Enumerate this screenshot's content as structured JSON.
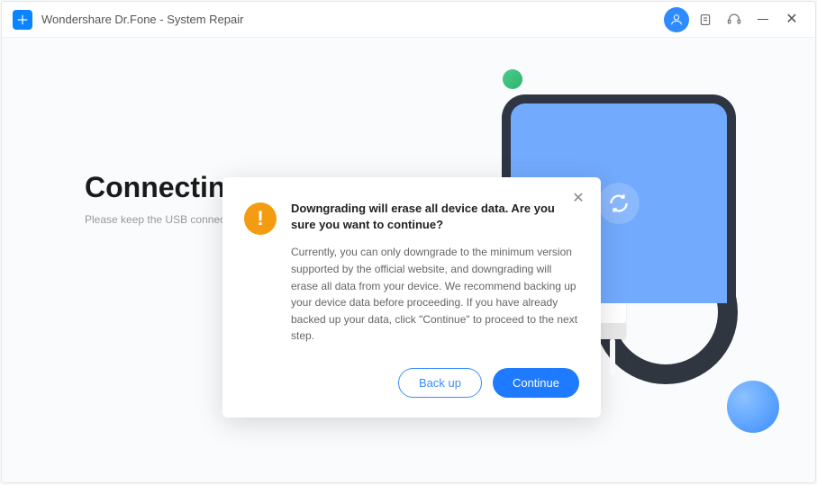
{
  "app": {
    "title": "Wondershare Dr.Fone - System Repair"
  },
  "background": {
    "headline": "Connecting...",
    "subtext": "Please keep the USB connection"
  },
  "modal": {
    "title": "Downgrading will erase all device data. Are you sure you want to continue?",
    "body": "Currently, you can only downgrade to the minimum version supported by the official website, and downgrading will erase all data from your device. We recommend backing up your device data before proceeding. If you have already backed up your data, click \"Continue\" to proceed to the next step.",
    "backup_label": "Back up",
    "continue_label": "Continue"
  }
}
